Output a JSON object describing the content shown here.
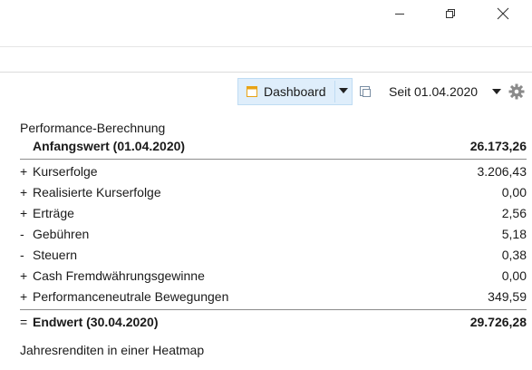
{
  "window": {
    "buttons": [
      "minimize",
      "restore",
      "close"
    ]
  },
  "toolbar": {
    "dashboard_label": "Dashboard",
    "period_label": "Seit 01.04.2020",
    "accent_color": "#dfeefb"
  },
  "performance": {
    "title": "Performance-Berechnung",
    "start": {
      "label": "Anfangswert (01.04.2020)",
      "value": "26.173,26"
    },
    "items": [
      {
        "sign": "+",
        "label": "Kurserfolge",
        "value": "3.206,43"
      },
      {
        "sign": "+",
        "label": "Realisierte Kurserfolge",
        "value": "0,00"
      },
      {
        "sign": "+",
        "label": "Erträge",
        "value": "2,56"
      },
      {
        "sign": "-",
        "label": "Gebühren",
        "value": "5,18"
      },
      {
        "sign": "-",
        "label": "Steuern",
        "value": "0,38"
      },
      {
        "sign": "+",
        "label": "Cash Fremdwährungsgewinne",
        "value": "0,00"
      },
      {
        "sign": "+",
        "label": "Performanceneutrale Bewegungen",
        "value": "349,59"
      }
    ],
    "end": {
      "sign": "=",
      "label": "Endwert (30.04.2020)",
      "value": "29.726,28"
    }
  },
  "footer": {
    "heatmap_label": "Jahresrenditen in einer Heatmap"
  }
}
